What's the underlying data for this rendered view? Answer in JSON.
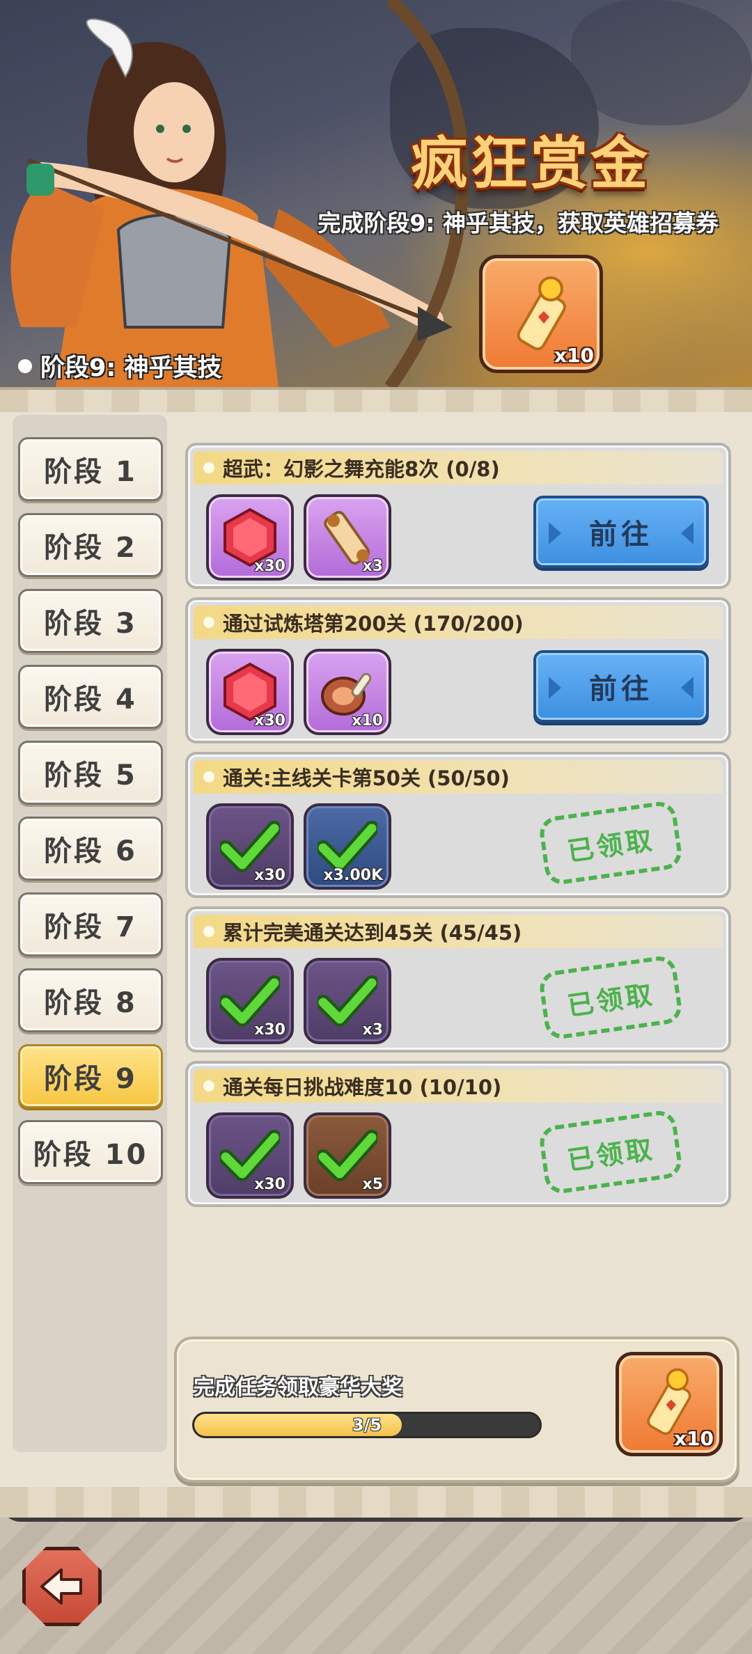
{
  "banner": {
    "title": "疯狂赏金",
    "subtitle": "完成阶段9: 神乎其技，获取英雄招募券",
    "reward_qty": "x10",
    "current_stage_label": "阶段9: 神乎其技"
  },
  "stages": [
    {
      "label": "阶段 1",
      "active": false
    },
    {
      "label": "阶段 2",
      "active": false
    },
    {
      "label": "阶段 3",
      "active": false
    },
    {
      "label": "阶段 4",
      "active": false
    },
    {
      "label": "阶段 5",
      "active": false
    },
    {
      "label": "阶段 6",
      "active": false
    },
    {
      "label": "阶段 7",
      "active": false
    },
    {
      "label": "阶段 8",
      "active": false
    },
    {
      "label": "阶段 9",
      "active": true
    },
    {
      "label": "阶段 10",
      "active": false
    }
  ],
  "tasks": [
    {
      "title": "超武：幻影之舞充能8次 (0/8)",
      "rewards": [
        {
          "icon": "red-gem-icon",
          "qty": "x30"
        },
        {
          "icon": "scroll-icon",
          "qty": "x3"
        }
      ],
      "status": "go",
      "action_label": "前往"
    },
    {
      "title": "通过试炼塔第200关 (170/200)",
      "rewards": [
        {
          "icon": "red-gem-icon",
          "qty": "x30"
        },
        {
          "icon": "meat-icon",
          "qty": "x10"
        }
      ],
      "status": "go",
      "action_label": "前往"
    },
    {
      "title": "通关:主线关卡第50关 (50/50)",
      "rewards": [
        {
          "icon": "red-gem-icon",
          "qty": "x30"
        },
        {
          "icon": "gold-coin-icon",
          "qty": "x3.00K"
        }
      ],
      "status": "claimed",
      "action_label": "已领取"
    },
    {
      "title": "累计完美通关达到45关 (45/45)",
      "rewards": [
        {
          "icon": "red-gem-icon",
          "qty": "x30"
        },
        {
          "icon": "scroll-icon",
          "qty": "x3"
        }
      ],
      "status": "claimed",
      "action_label": "已领取"
    },
    {
      "title": "通关每日挑战难度10 (10/10)",
      "rewards": [
        {
          "icon": "red-gem-icon",
          "qty": "x30"
        },
        {
          "icon": "meat-icon",
          "qty": "x5"
        }
      ],
      "status": "claimed",
      "action_label": "已领取"
    }
  ],
  "grand_reward": {
    "text": "完成任务领取豪华大奖",
    "progress_label": "3/5",
    "progress_fraction": 0.6,
    "reward_qty": "x10"
  },
  "colors": {
    "accent_gold": "#f6c642",
    "go_blue": "#3d8fe0",
    "claimed_green": "#4cb24c",
    "reward_orange": "#ef7a34"
  }
}
